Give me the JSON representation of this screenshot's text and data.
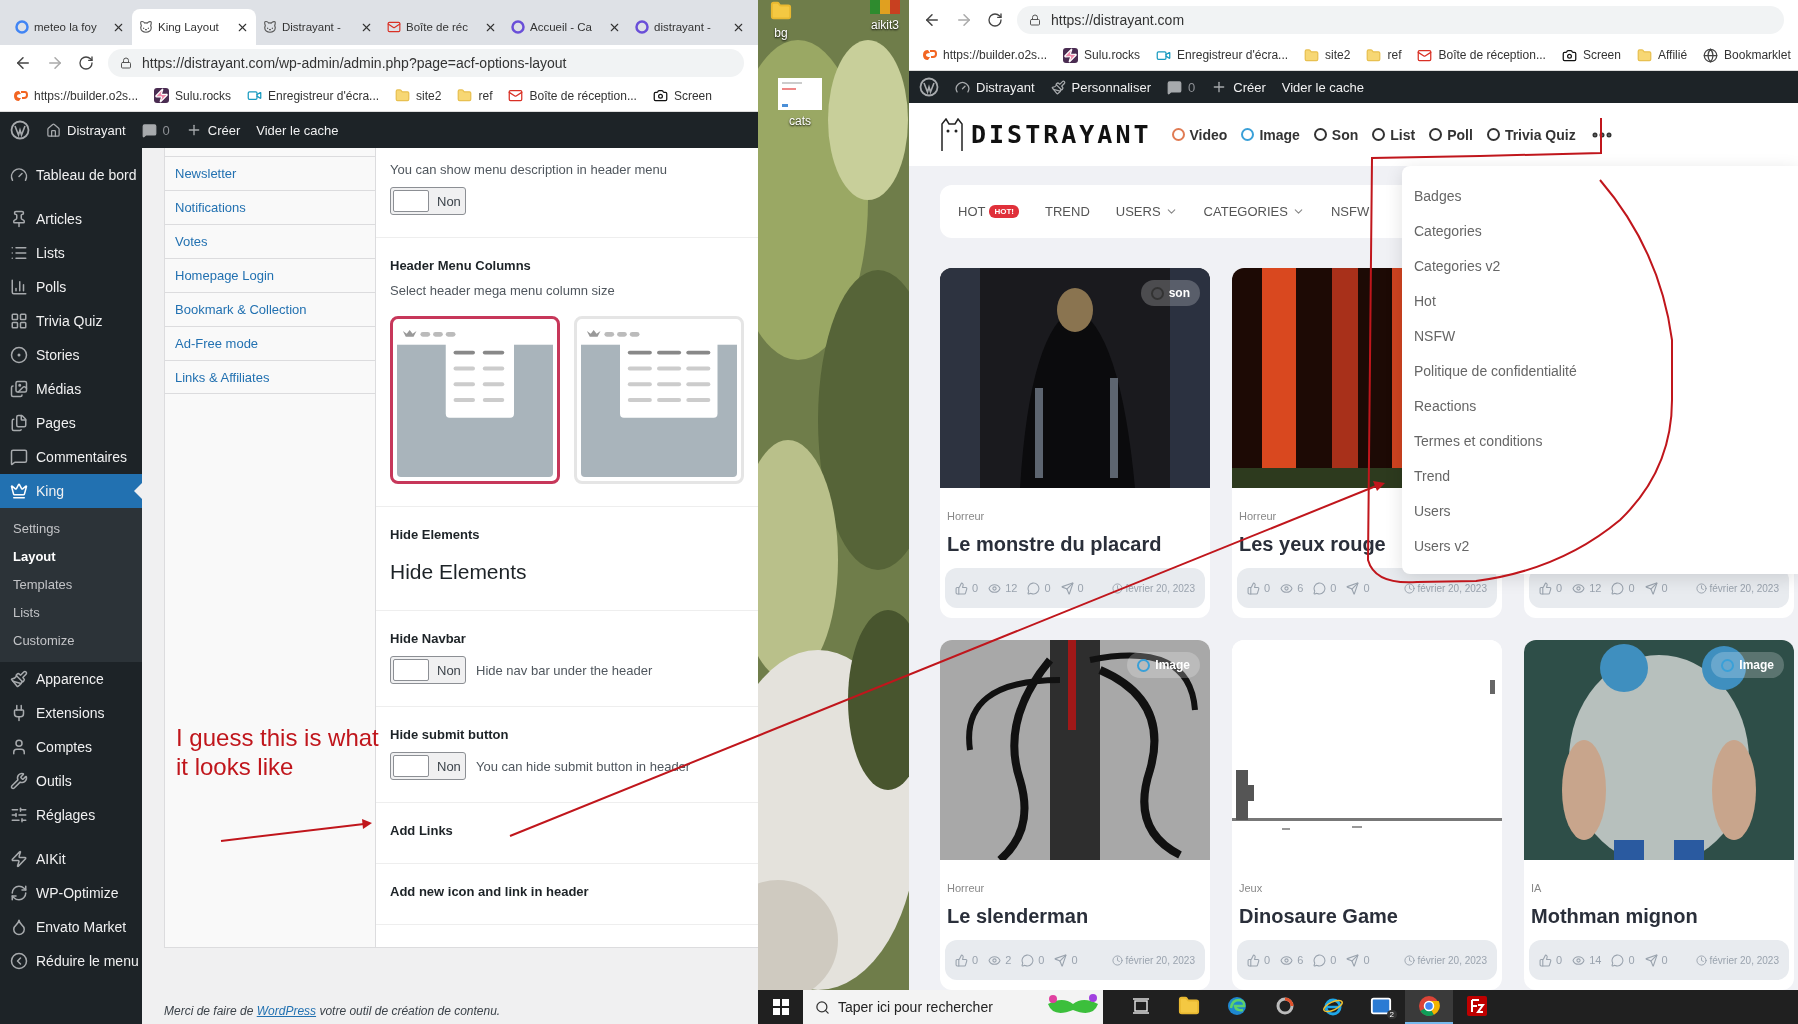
{
  "left_window": {
    "tabs": [
      {
        "title": "meteo la foy",
        "selected": false
      },
      {
        "title": "King Layout",
        "selected": true
      },
      {
        "title": "Distrayant -",
        "selected": false
      },
      {
        "title": "Boîte de réc",
        "selected": false
      },
      {
        "title": "Accueil - Ca",
        "selected": false
      },
      {
        "title": "distrayant -",
        "selected": false
      }
    ],
    "address": "https://distrayant.com/wp-admin/admin.php?page=acf-options-layout",
    "bookmarks": [
      "https://builder.o2s...",
      "Sulu.rocks",
      "Enregistreur d'écra...",
      "site2",
      "ref",
      "Boîte de réception...",
      "Screen"
    ],
    "admin_bar": {
      "site": "Distrayant",
      "comments": "0",
      "create": "Créer",
      "cache": "Vider le cache"
    },
    "sidebar": [
      [
        {
          "label": "Tableau de bord",
          "selected": false
        }
      ],
      [
        {
          "label": "Articles",
          "selected": false
        },
        {
          "label": "Lists",
          "selected": false
        },
        {
          "label": "Polls",
          "selected": false
        },
        {
          "label": "Trivia Quiz",
          "selected": false
        },
        {
          "label": "Stories",
          "selected": false
        },
        {
          "label": "Médias",
          "selected": false
        },
        {
          "label": "Pages",
          "selected": false
        },
        {
          "label": "Commentaires",
          "selected": false
        },
        {
          "label": "King",
          "selected": true,
          "children": [
            {
              "label": "Settings",
              "selected": false
            },
            {
              "label": "Layout",
              "selected": true
            },
            {
              "label": "Templates",
              "selected": false
            },
            {
              "label": "Lists",
              "selected": false
            },
            {
              "label": "Customize",
              "selected": false
            }
          ]
        },
        {
          "label": "Apparence",
          "selected": false
        },
        {
          "label": "Extensions",
          "selected": false
        },
        {
          "label": "Comptes",
          "selected": false
        },
        {
          "label": "Outils",
          "selected": false
        },
        {
          "label": "Réglages",
          "selected": false
        }
      ],
      [
        {
          "label": "AIKit",
          "selected": false
        },
        {
          "label": "WP-Optimize",
          "selected": false
        },
        {
          "label": "Envato Market",
          "selected": false
        },
        {
          "label": "Réduire le menu",
          "selected": false
        }
      ]
    ],
    "option_tabs": [
      {
        "label": "Newsletter"
      },
      {
        "label": "Notifications"
      },
      {
        "label": "Votes"
      },
      {
        "label": "Homepage Login"
      },
      {
        "label": "Bookmark & Collection"
      },
      {
        "label": "Ad-Free mode"
      },
      {
        "label": "Links & Affiliates"
      }
    ],
    "fields": [
      {
        "kind": "toggle",
        "description": "You can show menu description in header menu",
        "toggle": "Non",
        "on": false
      },
      {
        "kind": "columns",
        "label": "Header Menu Columns",
        "description": "Select header mega menu column size",
        "options": [
          {
            "kind": "two",
            "selected": true
          },
          {
            "kind": "three",
            "selected": false
          }
        ]
      },
      {
        "kind": "heading",
        "label": "Hide Elements",
        "title": "Hide Elements"
      },
      {
        "kind": "toggle",
        "label": "Hide Navbar",
        "toggle": "Non",
        "on": false,
        "hint": "Hide nav bar under the header"
      },
      {
        "kind": "toggle",
        "label": "Hide submit button",
        "toggle": "Non",
        "on": false,
        "hint": "You can hide submit button in header"
      },
      {
        "kind": "text",
        "label": "Add Links"
      },
      {
        "kind": "text",
        "label": "Add new icon and link in header"
      }
    ],
    "footer": {
      "text": "Merci de faire de",
      "link": "WordPress",
      "after": "votre outil de création de contenu."
    }
  },
  "desktop": {
    "icons": [
      {
        "label": "bg"
      },
      {
        "label": "aikit3"
      },
      {
        "label": "cats"
      }
    ]
  },
  "right_window": {
    "address": "https://distrayant.com",
    "bookmarks": [
      "https://builder.o2s...",
      "Sulu.rocks",
      "Enregistreur d'écra...",
      "site2",
      "ref",
      "Boîte de réception...",
      "Screen",
      "Affilié",
      "Bookmarklet"
    ],
    "admin_bar": {
      "site": "Distrayant",
      "customize": "Personnaliser",
      "comments": "0",
      "create": "Créer",
      "cache": "Vider le cache"
    },
    "logo": "DISTRAYANT",
    "post_types": [
      {
        "label": "Video",
        "color": "#e07b53"
      },
      {
        "label": "Image",
        "color": "#3aa0d8"
      },
      {
        "label": "Son",
        "color": "#333333"
      },
      {
        "label": "List",
        "color": "#333333"
      },
      {
        "label": "Poll",
        "color": "#333333"
      },
      {
        "label": "Trivia Quiz",
        "color": "#333333"
      }
    ],
    "nav": [
      {
        "label": "HOT",
        "badge": "HOT!",
        "dropdown": false
      },
      {
        "label": "TREND",
        "dropdown": false
      },
      {
        "label": "USERS",
        "dropdown": true
      },
      {
        "label": "CATEGORIES",
        "dropdown": true
      },
      {
        "label": "NSFW",
        "dropdown": false
      }
    ],
    "menu": [
      "Badges",
      "Categories",
      "Categories v2",
      "Hot",
      "NSFW",
      "Politique de confidentialité",
      "Reactions",
      "Termes et conditions",
      "Trend",
      "Users",
      "Users v2"
    ],
    "cards": [
      {
        "category": "Horreur",
        "title": "Le monstre du placard",
        "type": "son",
        "likes": "0",
        "views": "12",
        "comments": "0",
        "shares": "0",
        "date": "février 20, 2023"
      },
      {
        "category": "Horreur",
        "title": "Les yeux rouge",
        "likes": "0",
        "views": "6",
        "comments": "0",
        "shares": "0",
        "date": "février 20, 2023"
      },
      {
        "likes": "0",
        "views": "12",
        "comments": "0",
        "shares": "0",
        "date": "février 20, 2023"
      },
      {
        "category": "Horreur",
        "title": "Le slenderman",
        "type": "Image",
        "likes": "0",
        "views": "2",
        "comments": "0",
        "shares": "0",
        "date": "février 20, 2023"
      },
      {
        "category": "Jeux",
        "title": "Dinosaure Game",
        "likes": "0",
        "views": "6",
        "comments": "0",
        "shares": "0",
        "date": "février 20, 2023"
      },
      {
        "category": "IA",
        "title": "Mothman mignon",
        "type": "Image",
        "likes": "0",
        "views": "14",
        "comments": "0",
        "shares": "0",
        "date": "février 20, 2023"
      }
    ]
  },
  "taskbar": {
    "search_placeholder": "Taper ici pour rechercher",
    "apps": [
      {
        "selected": false
      },
      {
        "selected": false
      },
      {
        "selected": false
      },
      {
        "selected": false
      },
      {
        "selected": false
      },
      {
        "selected": false,
        "badge": "2"
      },
      {
        "selected": true
      },
      {
        "selected": false
      }
    ]
  },
  "annotation": {
    "note_lines": [
      "I guess this is what",
      "it looks like"
    ]
  }
}
